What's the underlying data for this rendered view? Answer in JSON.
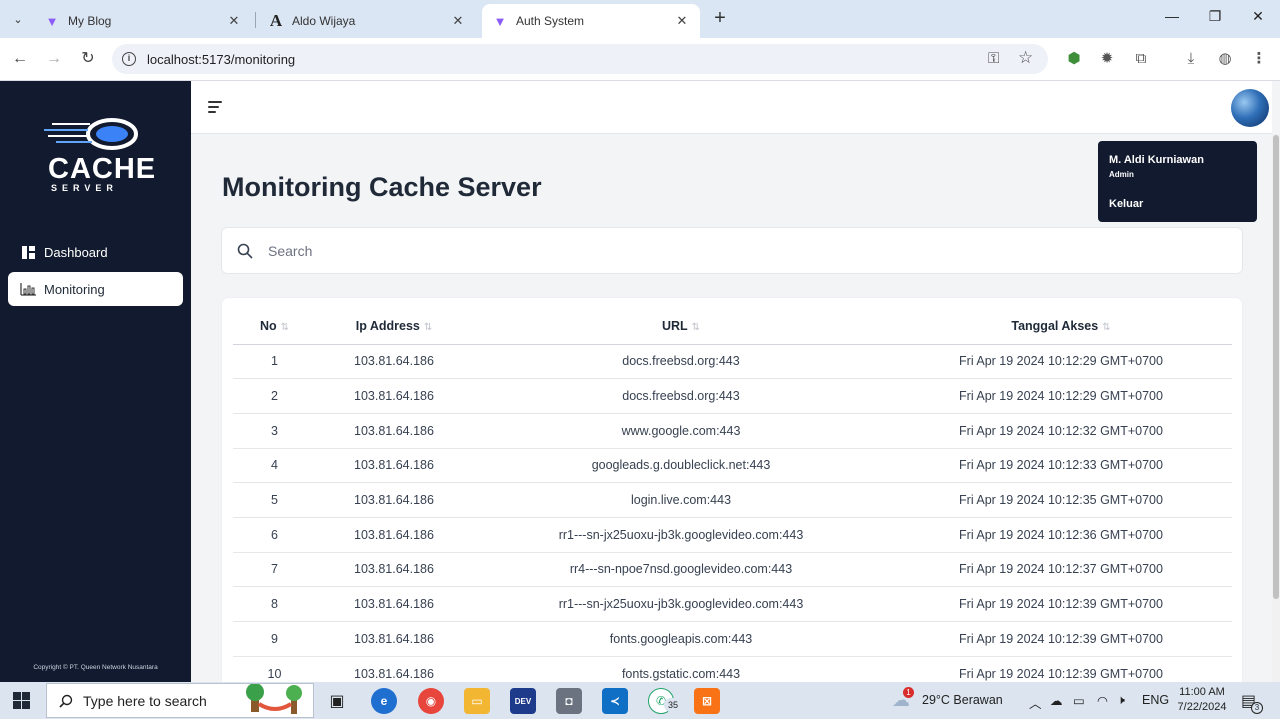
{
  "browser": {
    "tabs": [
      {
        "title": "My Blog",
        "icon": "vite-icon",
        "active": false
      },
      {
        "title": "Aldo Wijaya",
        "icon": "letter-a-icon",
        "active": false
      },
      {
        "title": "Auth System",
        "icon": "vite-icon",
        "active": true
      }
    ],
    "url": "localhost:5173/monitoring"
  },
  "sidebar": {
    "logo": {
      "main": "CACHE",
      "sub": "SERVER"
    },
    "items": [
      {
        "label": "Dashboard",
        "icon": "dashboard-icon",
        "active": false
      },
      {
        "label": "Monitoring",
        "icon": "bar-chart-icon",
        "active": true
      }
    ],
    "copyright": "Copyright © PT. Queen Network Nusantara"
  },
  "page": {
    "title": "Monitoring Cache Server",
    "search_placeholder": "Search"
  },
  "user_menu": {
    "name": "M. Aldi Kurniawan",
    "role": "Admin",
    "logout": "Keluar"
  },
  "table": {
    "headers": [
      "No",
      "Ip Address",
      "URL",
      "Tanggal Akses"
    ],
    "rows": [
      [
        "1",
        "103.81.64.186",
        "docs.freebsd.org:443",
        "Fri Apr 19 2024 10:12:29 GMT+0700"
      ],
      [
        "2",
        "103.81.64.186",
        "docs.freebsd.org:443",
        "Fri Apr 19 2024 10:12:29 GMT+0700"
      ],
      [
        "3",
        "103.81.64.186",
        "www.google.com:443",
        "Fri Apr 19 2024 10:12:32 GMT+0700"
      ],
      [
        "4",
        "103.81.64.186",
        "googleads.g.doubleclick.net:443",
        "Fri Apr 19 2024 10:12:33 GMT+0700"
      ],
      [
        "5",
        "103.81.64.186",
        "login.live.com:443",
        "Fri Apr 19 2024 10:12:35 GMT+0700"
      ],
      [
        "6",
        "103.81.64.186",
        "rr1---sn-jx25uoxu-jb3k.googlevideo.com:443",
        "Fri Apr 19 2024 10:12:36 GMT+0700"
      ],
      [
        "7",
        "103.81.64.186",
        "rr4---sn-npoe7nsd.googlevideo.com:443",
        "Fri Apr 19 2024 10:12:37 GMT+0700"
      ],
      [
        "8",
        "103.81.64.186",
        "rr1---sn-jx25uoxu-jb3k.googlevideo.com:443",
        "Fri Apr 19 2024 10:12:39 GMT+0700"
      ],
      [
        "9",
        "103.81.64.186",
        "fonts.googleapis.com:443",
        "Fri Apr 19 2024 10:12:39 GMT+0700"
      ],
      [
        "10",
        "103.81.64.186",
        "fonts.gstatic.com:443",
        "Fri Apr 19 2024 10:12:39 GMT+0700"
      ]
    ]
  },
  "taskbar": {
    "search_placeholder": "Type here to search",
    "whatsapp_badge": "35",
    "weather_badge": "1",
    "weather": "29°C  Berawan",
    "language": "ENG",
    "time": "11:00 AM",
    "date": "7/22/2024",
    "notification_count": "3"
  },
  "colors": {
    "sidebar_bg": "#111a2e",
    "page_bg": "#f3f4f6",
    "accent_vite": "#8b5cf6"
  }
}
